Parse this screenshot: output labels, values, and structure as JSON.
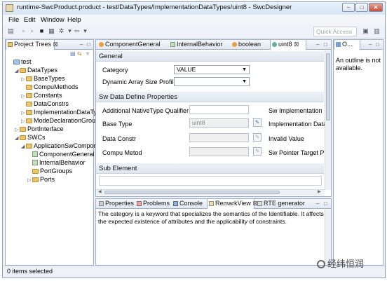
{
  "window": {
    "title": "runtime-SwcProduct.product - test/DataTypes/ImplementationDataTypes/uint8 - SwcDesigner",
    "buttons": [
      "–",
      "□",
      "✕"
    ]
  },
  "menu": [
    "File",
    "Edit",
    "Window",
    "Help"
  ],
  "toolbar": {
    "quick_access": "Quick Access"
  },
  "project_tree": {
    "tab_label": "Project Trees",
    "items": [
      {
        "label": "test",
        "depth": 0,
        "kind": "root",
        "twisty": ""
      },
      {
        "label": "DataTypes",
        "depth": 1,
        "kind": "folder",
        "twisty": "◢"
      },
      {
        "label": "BaseTypes",
        "depth": 2,
        "kind": "folder",
        "twisty": "▷"
      },
      {
        "label": "CompuMethods",
        "depth": 2,
        "kind": "folder",
        "twisty": ""
      },
      {
        "label": "Constants",
        "depth": 2,
        "kind": "folder",
        "twisty": "▷"
      },
      {
        "label": "DataConstrs",
        "depth": 2,
        "kind": "folder",
        "twisty": ""
      },
      {
        "label": "ImplementationDataTy",
        "depth": 2,
        "kind": "folder",
        "twisty": "▷"
      },
      {
        "label": "ModeDeclarationGrou",
        "depth": 2,
        "kind": "folder",
        "twisty": "▷"
      },
      {
        "label": "PortInterface",
        "depth": 1,
        "kind": "folder",
        "twisty": "▷"
      },
      {
        "label": "SWCs",
        "depth": 1,
        "kind": "folder",
        "twisty": "◢"
      },
      {
        "label": "ApplicationSwCompor",
        "depth": 2,
        "kind": "folder",
        "twisty": "◢"
      },
      {
        "label": "ComponentGeneral",
        "depth": 3,
        "kind": "leaf",
        "twisty": ""
      },
      {
        "label": "InternalBehavior",
        "depth": 3,
        "kind": "leaf",
        "twisty": ""
      },
      {
        "label": "PortGroups",
        "depth": 3,
        "kind": "folder",
        "twisty": ""
      },
      {
        "label": "Ports",
        "depth": 3,
        "kind": "folder",
        "twisty": "▷"
      }
    ]
  },
  "editor": {
    "tabs": [
      "ComponentGeneral",
      "InternalBehavior",
      "boolean",
      "uint8"
    ],
    "general": {
      "header": "General",
      "category_label": "Category",
      "category_value": "VALUE",
      "array_label": "Dynamic Array Size Profile",
      "array_value": ""
    },
    "sw": {
      "header": "Sw Data Define Properties",
      "native_label": "Additional NativeType Qualifier",
      "native_value": "",
      "base_label": "Base Type",
      "base_value": "uint8",
      "constr_label": "Data Constr",
      "constr_value": "",
      "compu_label": "Compu Metod",
      "compu_value": "",
      "right_labels": [
        "Sw Implementation",
        "Implementation Data",
        "Invalid Value",
        "Sw Pointer Target Pr"
      ]
    },
    "sub_element_header": "Sub Element"
  },
  "outline": {
    "tab_label": "O...",
    "message": "An outline is not available."
  },
  "bottom": {
    "tabs": [
      "Properties",
      "Problems",
      "Console",
      "RemarkView",
      "RTE generator"
    ],
    "text": "The category is a keyword that specializes the semantics of the Identifiable. It affects the expected existence of attributes and the applicability of constraints."
  },
  "status_bar": {
    "text": "0 items selected"
  },
  "watermark": "经纬恒润"
}
